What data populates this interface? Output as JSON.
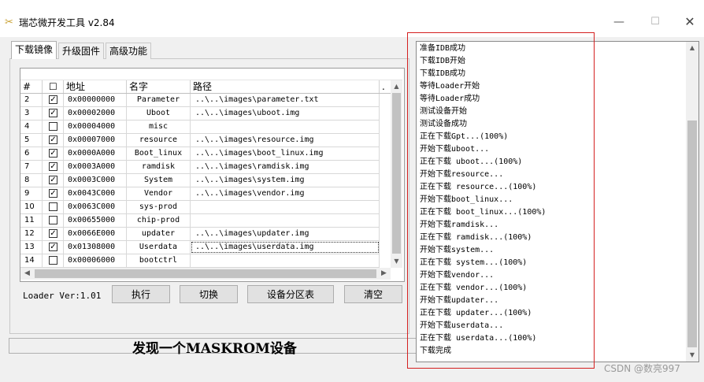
{
  "window": {
    "title": "瑞芯微开发工具 v2.84",
    "icon": "tools-icon",
    "controls": {
      "minimize": "—",
      "maximize": "☐",
      "close": "✕"
    }
  },
  "tabs": [
    {
      "label": "下载镜像",
      "active": true
    },
    {
      "label": "升级固件",
      "active": false
    },
    {
      "label": "高级功能",
      "active": false
    }
  ],
  "table": {
    "columns": [
      "#",
      "☐",
      "地址",
      "名字",
      "路径",
      "."
    ],
    "rows": [
      {
        "num": "2",
        "checked": true,
        "address": "0x00000000",
        "name": "Parameter",
        "path": "..\\..\\images\\parameter.txt"
      },
      {
        "num": "3",
        "checked": true,
        "address": "0x00002000",
        "name": "Uboot",
        "path": "..\\..\\images\\uboot.img"
      },
      {
        "num": "4",
        "checked": false,
        "address": "0x00004000",
        "name": "misc",
        "path": ""
      },
      {
        "num": "5",
        "checked": true,
        "address": "0x00007000",
        "name": "resource",
        "path": "..\\..\\images\\resource.img"
      },
      {
        "num": "6",
        "checked": true,
        "address": "0x0000A000",
        "name": "Boot_linux",
        "path": "..\\..\\images\\boot_linux.img"
      },
      {
        "num": "7",
        "checked": true,
        "address": "0x0003A000",
        "name": "ramdisk",
        "path": "..\\..\\images\\ramdisk.img"
      },
      {
        "num": "8",
        "checked": true,
        "address": "0x0003C000",
        "name": "System",
        "path": "..\\..\\images\\system.img"
      },
      {
        "num": "9",
        "checked": true,
        "address": "0x0043C000",
        "name": "Vendor",
        "path": "..\\..\\images\\vendor.img"
      },
      {
        "num": "10",
        "checked": false,
        "address": "0x0063C000",
        "name": "sys-prod",
        "path": ""
      },
      {
        "num": "11",
        "checked": false,
        "address": "0x00655000",
        "name": "chip-prod",
        "path": ""
      },
      {
        "num": "12",
        "checked": true,
        "address": "0x0066E000",
        "name": "updater",
        "path": "..\\..\\images\\updater.img"
      },
      {
        "num": "13",
        "checked": true,
        "address": "0x01308000",
        "name": "Userdata",
        "path": "..\\..\\images\\userdata.img",
        "selected": true
      },
      {
        "num": "14",
        "checked": false,
        "address": "0x00006000",
        "name": "bootctrl",
        "path": ""
      }
    ]
  },
  "loader_version": "Loader Ver:1.01",
  "buttons": {
    "run": "执行",
    "switch": "切换",
    "partition": "设备分区表",
    "clear": "清空"
  },
  "status": "发现一个MASKROM设备",
  "log": [
    "准备IDB成功",
    "下载IDB开始",
    "下载IDB成功",
    "等待Loader开始",
    "等待Loader成功",
    "测试设备开始",
    "测试设备成功",
    "正在下载Gpt...(100%)",
    "开始下载uboot...",
    "正在下载 uboot...(100%)",
    "开始下载resource...",
    "正在下载 resource...(100%)",
    "开始下载boot_linux...",
    "正在下载 boot_linux...(100%)",
    "开始下载ramdisk...",
    "正在下载 ramdisk...(100%)",
    "开始下载system...",
    "正在下载 system...(100%)",
    "开始下载vendor...",
    "正在下载 vendor...(100%)",
    "开始下载updater...",
    "正在下载 updater...(100%)",
    "开始下载userdata...",
    "正在下载 userdata...(100%)",
    "下载完成"
  ],
  "watermark": "CSDN @数亮997",
  "colors": {
    "highlight_frame": "#d42020"
  }
}
